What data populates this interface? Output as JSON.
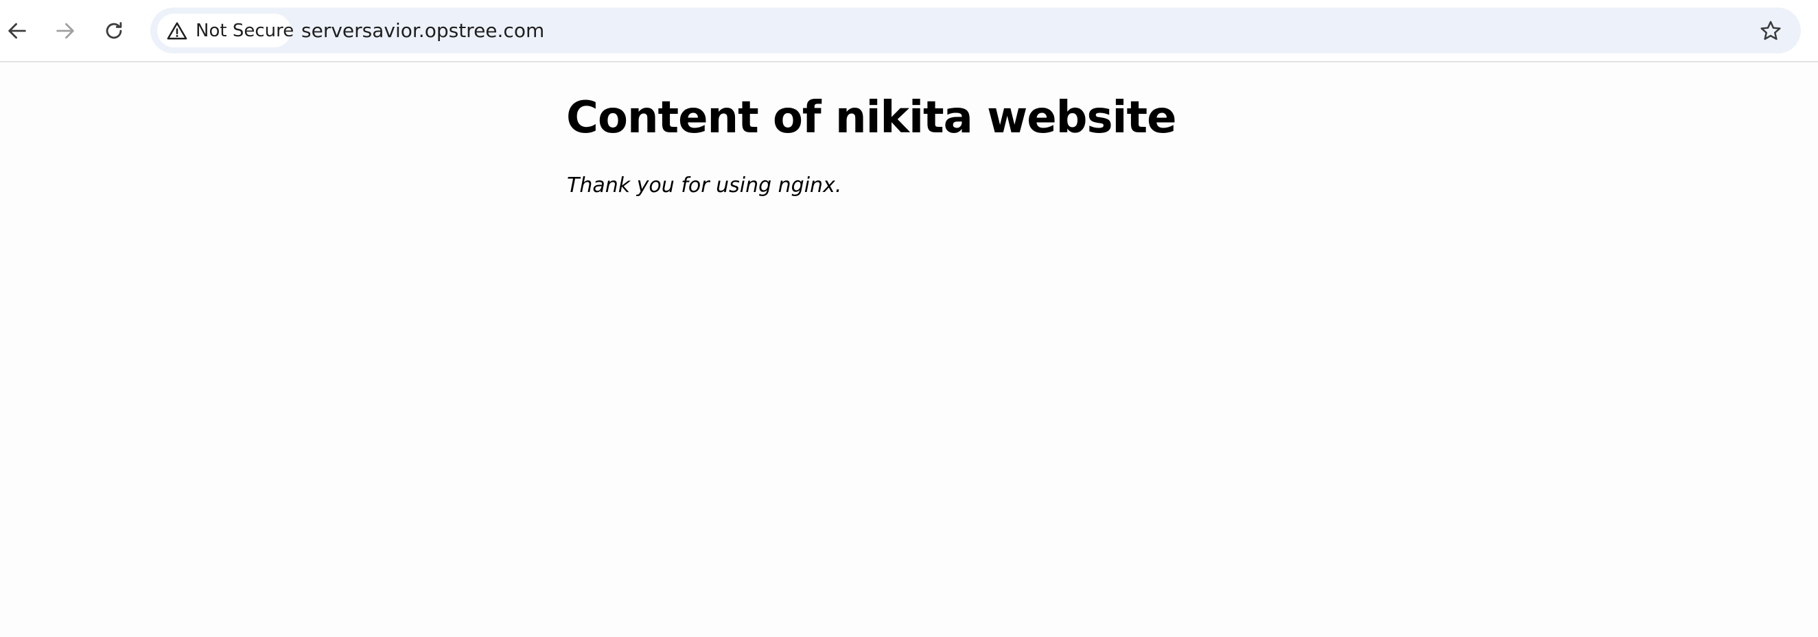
{
  "browser": {
    "nav": {
      "back_icon": "arrow-left-icon",
      "forward_icon": "arrow-right-icon",
      "reload_icon": "reload-icon"
    },
    "omnibox": {
      "security_label": "Not Secure",
      "security_icon": "warning-triangle-icon",
      "url": "serversavior.opstree.com",
      "bookmark_icon": "star-icon"
    }
  },
  "page": {
    "heading": "Content of nikita website",
    "body_text": "Thank you for using nginx."
  },
  "colors": {
    "omnibox_bg": "#edf2fa",
    "forward_disabled": "#a0a0a0",
    "icon": "#3c3c3c",
    "text": "#000000"
  }
}
